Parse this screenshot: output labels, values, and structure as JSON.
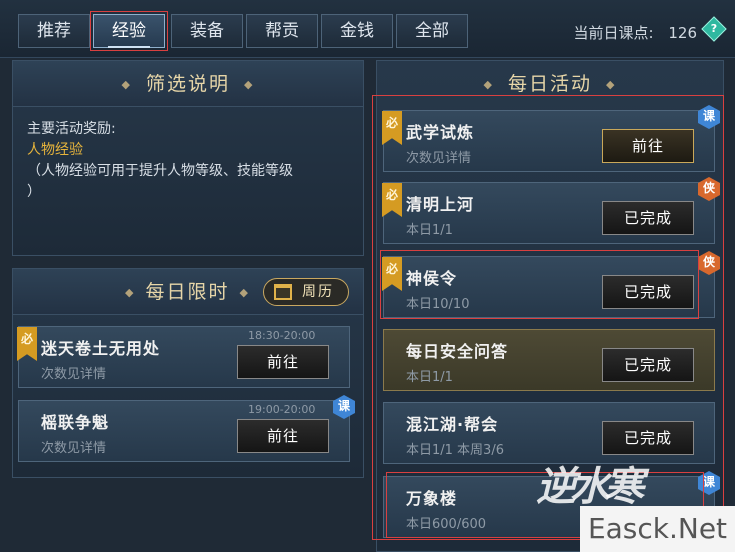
{
  "tabs": [
    {
      "label": "推荐"
    },
    {
      "label": "经验"
    },
    {
      "label": "装备"
    },
    {
      "label": "帮贡"
    },
    {
      "label": "金钱"
    },
    {
      "label": "全部"
    }
  ],
  "active_points": {
    "label": "当前日课点:",
    "value": "126"
  },
  "filter_panel": {
    "title": "筛选说明",
    "line1": "主要活动奖励:",
    "line2": "人物经验",
    "line3": "（人物经验可用于提升人物等级、技能等级",
    "line4": "）"
  },
  "limited_panel": {
    "title": "每日限时",
    "calendar_label": "周历",
    "items": [
      {
        "title": "迷天卷土无用处",
        "sub": "次数见详情",
        "time": "18:30-20:00",
        "button": "前往",
        "must": "必",
        "badge": ""
      },
      {
        "title": "榣联争魁",
        "sub": "次数见详情",
        "time": "19:00-20:00",
        "button": "前往",
        "must": "",
        "badge": "课"
      }
    ]
  },
  "daily_panel": {
    "title": "每日活动",
    "items": [
      {
        "title": "武学试炼",
        "sub": "次数见详情",
        "button": "前往",
        "must": "必",
        "badge": "课"
      },
      {
        "title": "清明上河",
        "sub": "本日1/1",
        "button": "已完成",
        "must": "必",
        "badge": "侠"
      },
      {
        "title": "神侯令",
        "sub": "本日10/10",
        "button": "已完成",
        "must": "必",
        "badge": "侠"
      },
      {
        "title": "每日安全问答",
        "sub": "本日1/1",
        "button": "已完成",
        "must": "",
        "badge": ""
      },
      {
        "title": "混江湖·帮会",
        "sub": "本日1/1  本周3/6",
        "button": "已完成",
        "must": "",
        "badge": ""
      },
      {
        "title": "万象楼",
        "sub": "本日600/600",
        "button": "",
        "must": "",
        "badge": "课"
      }
    ]
  },
  "watermark": {
    "text": "Easck.Net",
    "logo": "逆水寒"
  },
  "colors": {
    "accent_gold": "#e6b43c",
    "must_tag": "#d59b22",
    "badge_ke": "#3f86d6",
    "badge_xia": "#d8682d",
    "highlight_box": "#d94040"
  }
}
